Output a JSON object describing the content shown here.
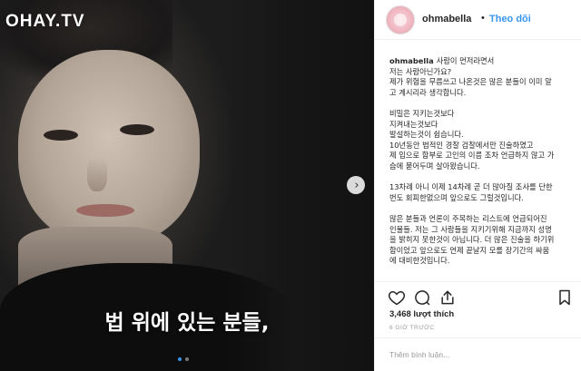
{
  "watermark": "OHAY.TV",
  "photo": {
    "subtitle": "법 위에 있는 분들,",
    "carousel_dots": 2,
    "active_dot": 1
  },
  "header": {
    "username": "ohmabella",
    "separator": "•",
    "follow_label": "Theo dõi"
  },
  "caption": {
    "username": "ohmabella",
    "lines": [
      "사람이 먼저라면서",
      "저는 사람아닌가요?",
      "제가 위험을 무릅쓰고 나온것은 많은 분들이 이미 알",
      "고 계시리라 생각합니다.",
      "",
      "비밀은 지키는것보다",
      "지켜내는것보다",
      "발설하는것이 쉽습니다.",
      "10년동안 법적인 경찰 검찰에서만 진술하였고",
      "제 입으로 함부로 고인의 이름 조차 언급하지 않고 가",
      "슴에 묻어두며 살아왔습니다.",
      "",
      "13차례 아니 이제 14차례 곧 더 많아질 조사를 단한",
      "번도 회피한없으며 앞으로도 그럴것입니다.",
      "",
      "많은 분들과 언론이 주목하는 리스트에 언급되어진",
      "인물들. 저는 그 사람들을 지키기위해 지금까지 성명",
      "을 밝히지 못한것이 아닙니다. 더 많은 진술을 하기위",
      "함이었고 앞으로도 언제 끝날지 모를 장기간의 싸움",
      "에 대비한것입니다."
    ]
  },
  "actions": {
    "like_icon": "heart-icon",
    "comment_icon": "comment-icon",
    "share_icon": "share-icon",
    "save_icon": "bookmark-icon"
  },
  "likes_text": "3,468 lượt thích",
  "time_text": "6 GIỜ TRƯỚC",
  "comment_placeholder": "Thêm bình luận..."
}
